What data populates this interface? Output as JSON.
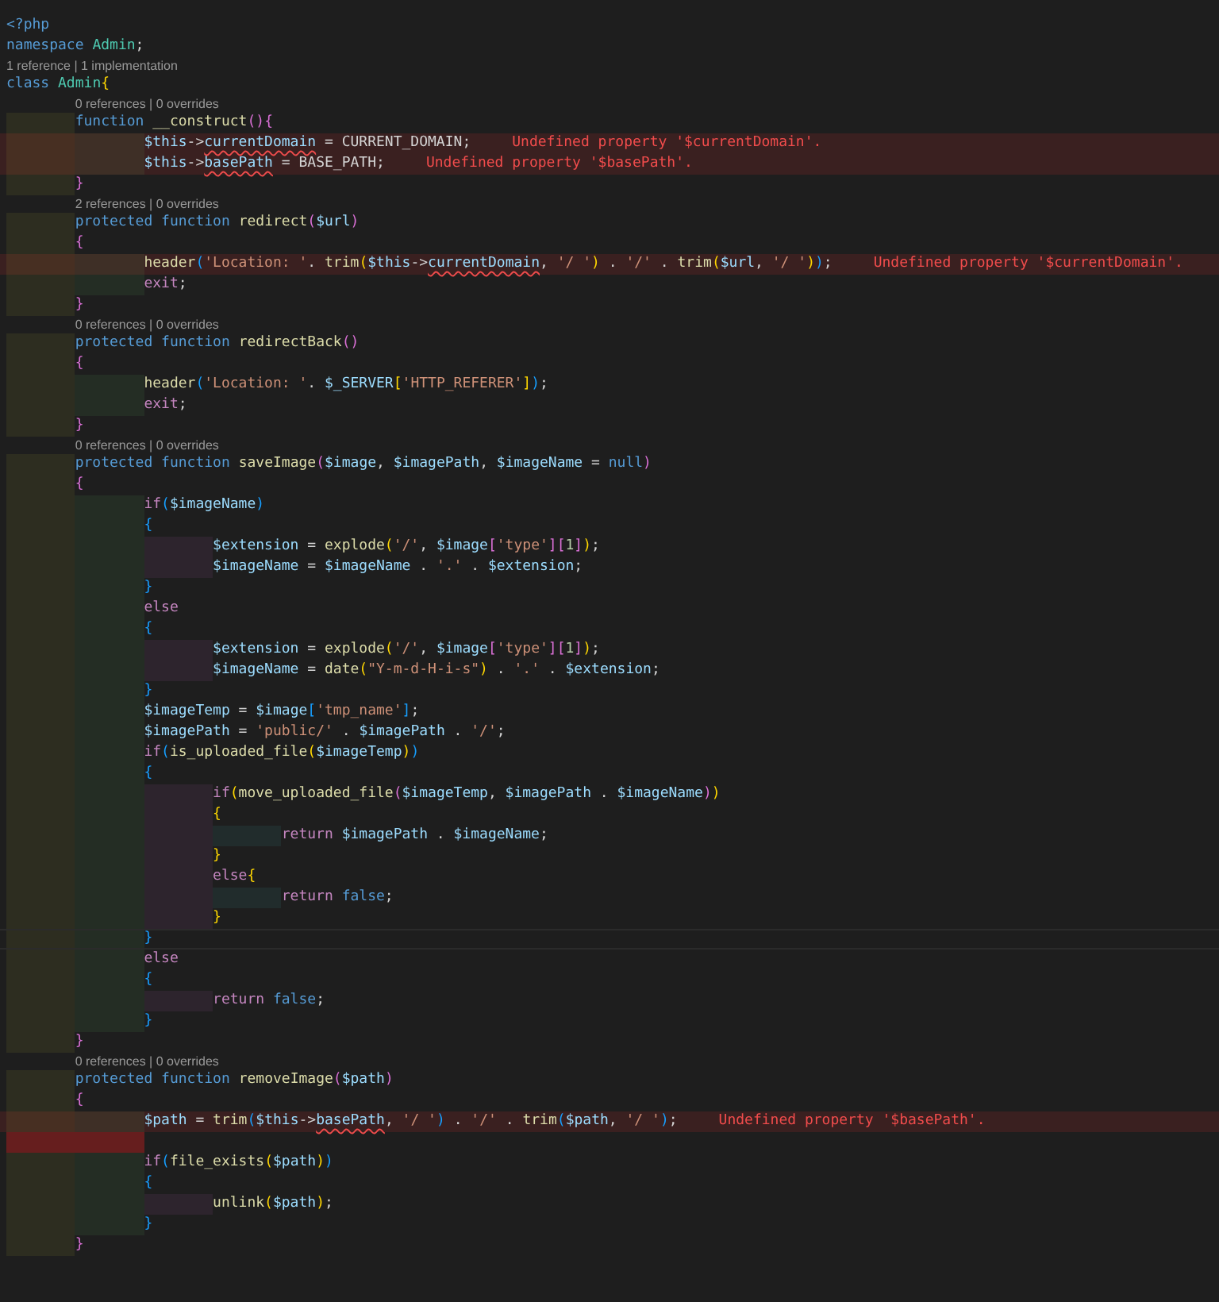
{
  "lines": [
    {
      "kind": "code",
      "tokens": [
        {
          "kind": "kw",
          "text": "<?php"
        }
      ]
    },
    {
      "kind": "code",
      "tokens": [
        {
          "kind": "kw",
          "text": "namespace "
        },
        {
          "kind": "cls",
          "text": "Admin"
        },
        {
          "kind": "txt",
          "text": ";"
        }
      ]
    },
    {
      "kind": "lens",
      "text": "1 reference | 1 implementation"
    },
    {
      "kind": "code",
      "tokens": [
        {
          "kind": "kw",
          "text": "class "
        },
        {
          "kind": "cls",
          "text": "Admin"
        },
        {
          "kind": "b1",
          "text": "{"
        }
      ],
      "children": [
        {
          "kind": "lens",
          "text": "0 references | 0 overrides"
        },
        {
          "kind": "code",
          "tokens": [
            {
              "kind": "kw",
              "text": "function "
            },
            {
              "kind": "fn",
              "text": "__construct"
            },
            {
              "kind": "b2",
              "text": "()"
            },
            {
              "kind": "b2",
              "text": "{"
            }
          ],
          "children": [
            {
              "kind": "code",
              "tokens": [
                {
                  "kind": "var",
                  "text": "$this"
                },
                {
                  "kind": "txt",
                  "text": "->"
                },
                {
                  "kind": "err",
                  "text": "currentDomain"
                },
                {
                  "kind": "txt",
                  "text": " = CURRENT_DOMAIN;"
                }
              ],
              "error": "Undefined property '$currentDomain'."
            },
            {
              "kind": "code",
              "tokens": [
                {
                  "kind": "var",
                  "text": "$this"
                },
                {
                  "kind": "txt",
                  "text": "->"
                },
                {
                  "kind": "err",
                  "text": "basePath"
                },
                {
                  "kind": "txt",
                  "text": " = BASE_PATH;"
                }
              ],
              "error": "Undefined property '$basePath'."
            }
          ]
        },
        {
          "kind": "code",
          "tokens": [
            {
              "kind": "b2",
              "text": "}"
            }
          ]
        },
        {
          "kind": "lens",
          "text": "2 references | 0 overrides"
        },
        {
          "kind": "code",
          "tokens": [
            {
              "kind": "kw",
              "text": "protected "
            },
            {
              "kind": "kw",
              "text": "function "
            },
            {
              "kind": "fn",
              "text": "redirect"
            },
            {
              "kind": "b2",
              "text": "("
            },
            {
              "kind": "var",
              "text": "$url"
            },
            {
              "kind": "b2",
              "text": ")"
            }
          ]
        },
        {
          "kind": "code",
          "tokens": [
            {
              "kind": "b2",
              "text": "{"
            }
          ],
          "children": [
            {
              "kind": "code",
              "tokens": [
                {
                  "kind": "fn",
                  "text": "header"
                },
                {
                  "kind": "b3",
                  "text": "("
                },
                {
                  "kind": "str",
                  "text": "'Location: '"
                },
                {
                  "kind": "txt",
                  "text": ". "
                },
                {
                  "kind": "fn",
                  "text": "trim"
                },
                {
                  "kind": "b1",
                  "text": "("
                },
                {
                  "kind": "var",
                  "text": "$this"
                },
                {
                  "kind": "txt",
                  "text": "->"
                },
                {
                  "kind": "err",
                  "text": "currentDomain"
                },
                {
                  "kind": "txt",
                  "text": ", "
                },
                {
                  "kind": "str",
                  "text": "'/ '"
                },
                {
                  "kind": "b1",
                  "text": ")"
                },
                {
                  "kind": "txt",
                  "text": " . "
                },
                {
                  "kind": "str",
                  "text": "'/'"
                },
                {
                  "kind": "txt",
                  "text": " . "
                },
                {
                  "kind": "fn",
                  "text": "trim"
                },
                {
                  "kind": "b1",
                  "text": "("
                },
                {
                  "kind": "var",
                  "text": "$url"
                },
                {
                  "kind": "txt",
                  "text": ", "
                },
                {
                  "kind": "str",
                  "text": "'/ '"
                },
                {
                  "kind": "b1",
                  "text": ")"
                },
                {
                  "kind": "b3",
                  "text": ")"
                },
                {
                  "kind": "txt",
                  "text": ";"
                }
              ],
              "error": "Undefined property '$currentDomain'."
            },
            {
              "kind": "code",
              "tokens": [
                {
                  "kind": "ctl",
                  "text": "exit"
                },
                {
                  "kind": "txt",
                  "text": ";"
                }
              ]
            }
          ]
        },
        {
          "kind": "code",
          "tokens": [
            {
              "kind": "b2",
              "text": "}"
            }
          ]
        },
        {
          "kind": "lens",
          "text": "0 references | 0 overrides"
        },
        {
          "kind": "code",
          "tokens": [
            {
              "kind": "kw",
              "text": "protected "
            },
            {
              "kind": "kw",
              "text": "function "
            },
            {
              "kind": "fn",
              "text": "redirectBack"
            },
            {
              "kind": "b2",
              "text": "()"
            }
          ]
        },
        {
          "kind": "code",
          "tokens": [
            {
              "kind": "b2",
              "text": "{"
            }
          ],
          "children": [
            {
              "kind": "code",
              "tokens": [
                {
                  "kind": "fn",
                  "text": "header"
                },
                {
                  "kind": "b3",
                  "text": "("
                },
                {
                  "kind": "str",
                  "text": "'Location: '"
                },
                {
                  "kind": "txt",
                  "text": ". "
                },
                {
                  "kind": "var",
                  "text": "$_SERVER"
                },
                {
                  "kind": "b1",
                  "text": "["
                },
                {
                  "kind": "str",
                  "text": "'HTTP_REFERER'"
                },
                {
                  "kind": "b1",
                  "text": "]"
                },
                {
                  "kind": "b3",
                  "text": ")"
                },
                {
                  "kind": "txt",
                  "text": ";"
                }
              ]
            },
            {
              "kind": "code",
              "tokens": [
                {
                  "kind": "ctl",
                  "text": "exit"
                },
                {
                  "kind": "txt",
                  "text": ";"
                }
              ]
            }
          ]
        },
        {
          "kind": "code",
          "tokens": [
            {
              "kind": "b2",
              "text": "}"
            }
          ]
        },
        {
          "kind": "lens",
          "text": "0 references | 0 overrides"
        },
        {
          "kind": "code",
          "tokens": [
            {
              "kind": "kw",
              "text": "protected "
            },
            {
              "kind": "kw",
              "text": "function "
            },
            {
              "kind": "fn",
              "text": "saveImage"
            },
            {
              "kind": "b2",
              "text": "("
            },
            {
              "kind": "var",
              "text": "$image"
            },
            {
              "kind": "txt",
              "text": ", "
            },
            {
              "kind": "var",
              "text": "$imagePath"
            },
            {
              "kind": "txt",
              "text": ", "
            },
            {
              "kind": "var",
              "text": "$imageName"
            },
            {
              "kind": "txt",
              "text": " = "
            },
            {
              "kind": "kw",
              "text": "null"
            },
            {
              "kind": "b2",
              "text": ")"
            }
          ]
        },
        {
          "kind": "code",
          "tokens": [
            {
              "kind": "b2",
              "text": "{"
            }
          ],
          "children": [
            {
              "kind": "code",
              "tokens": [
                {
                  "kind": "ctl",
                  "text": "if"
                },
                {
                  "kind": "b3",
                  "text": "("
                },
                {
                  "kind": "var",
                  "text": "$imageName"
                },
                {
                  "kind": "b3",
                  "text": ")"
                }
              ]
            },
            {
              "kind": "code",
              "tokens": [
                {
                  "kind": "b3",
                  "text": "{"
                }
              ],
              "children": [
                {
                  "kind": "code",
                  "tokens": [
                    {
                      "kind": "var",
                      "text": "$extension"
                    },
                    {
                      "kind": "txt",
                      "text": " = "
                    },
                    {
                      "kind": "fn",
                      "text": "explode"
                    },
                    {
                      "kind": "b1",
                      "text": "("
                    },
                    {
                      "kind": "str",
                      "text": "'/'"
                    },
                    {
                      "kind": "txt",
                      "text": ", "
                    },
                    {
                      "kind": "var",
                      "text": "$image"
                    },
                    {
                      "kind": "b2",
                      "text": "["
                    },
                    {
                      "kind": "str",
                      "text": "'type'"
                    },
                    {
                      "kind": "b2",
                      "text": "]["
                    },
                    {
                      "kind": "num",
                      "text": "1"
                    },
                    {
                      "kind": "b2",
                      "text": "]"
                    },
                    {
                      "kind": "b1",
                      "text": ")"
                    },
                    {
                      "kind": "txt",
                      "text": ";"
                    }
                  ]
                },
                {
                  "kind": "code",
                  "tokens": [
                    {
                      "kind": "var",
                      "text": "$imageName"
                    },
                    {
                      "kind": "txt",
                      "text": " = "
                    },
                    {
                      "kind": "var",
                      "text": "$imageName"
                    },
                    {
                      "kind": "txt",
                      "text": " . "
                    },
                    {
                      "kind": "str",
                      "text": "'.'"
                    },
                    {
                      "kind": "txt",
                      "text": " . "
                    },
                    {
                      "kind": "var",
                      "text": "$extension"
                    },
                    {
                      "kind": "txt",
                      "text": ";"
                    }
                  ]
                }
              ]
            },
            {
              "kind": "code",
              "tokens": [
                {
                  "kind": "b3",
                  "text": "}"
                }
              ]
            },
            {
              "kind": "code",
              "tokens": [
                {
                  "kind": "ctl",
                  "text": "else"
                }
              ]
            },
            {
              "kind": "code",
              "tokens": [
                {
                  "kind": "b3",
                  "text": "{"
                }
              ],
              "children": [
                {
                  "kind": "code",
                  "tokens": [
                    {
                      "kind": "var",
                      "text": "$extension"
                    },
                    {
                      "kind": "txt",
                      "text": " = "
                    },
                    {
                      "kind": "fn",
                      "text": "explode"
                    },
                    {
                      "kind": "b1",
                      "text": "("
                    },
                    {
                      "kind": "str",
                      "text": "'/'"
                    },
                    {
                      "kind": "txt",
                      "text": ", "
                    },
                    {
                      "kind": "var",
                      "text": "$image"
                    },
                    {
                      "kind": "b2",
                      "text": "["
                    },
                    {
                      "kind": "str",
                      "text": "'type'"
                    },
                    {
                      "kind": "b2",
                      "text": "]["
                    },
                    {
                      "kind": "num",
                      "text": "1"
                    },
                    {
                      "kind": "b2",
                      "text": "]"
                    },
                    {
                      "kind": "b1",
                      "text": ")"
                    },
                    {
                      "kind": "txt",
                      "text": ";"
                    }
                  ]
                },
                {
                  "kind": "code",
                  "tokens": [
                    {
                      "kind": "var",
                      "text": "$imageName"
                    },
                    {
                      "kind": "txt",
                      "text": " = "
                    },
                    {
                      "kind": "fn",
                      "text": "date"
                    },
                    {
                      "kind": "b1",
                      "text": "("
                    },
                    {
                      "kind": "str",
                      "text": "\"Y-m-d-H-i-s\""
                    },
                    {
                      "kind": "b1",
                      "text": ")"
                    },
                    {
                      "kind": "txt",
                      "text": " . "
                    },
                    {
                      "kind": "str",
                      "text": "'.'"
                    },
                    {
                      "kind": "txt",
                      "text": " . "
                    },
                    {
                      "kind": "var",
                      "text": "$extension"
                    },
                    {
                      "kind": "txt",
                      "text": ";"
                    }
                  ]
                }
              ]
            },
            {
              "kind": "code",
              "tokens": [
                {
                  "kind": "b3",
                  "text": "}"
                }
              ]
            },
            {
              "kind": "code",
              "tokens": [
                {
                  "kind": "var",
                  "text": "$imageTemp"
                },
                {
                  "kind": "txt",
                  "text": " = "
                },
                {
                  "kind": "var",
                  "text": "$image"
                },
                {
                  "kind": "b3",
                  "text": "["
                },
                {
                  "kind": "str",
                  "text": "'tmp_name'"
                },
                {
                  "kind": "b3",
                  "text": "]"
                },
                {
                  "kind": "txt",
                  "text": ";"
                }
              ]
            },
            {
              "kind": "code",
              "tokens": [
                {
                  "kind": "var",
                  "text": "$imagePath"
                },
                {
                  "kind": "txt",
                  "text": " = "
                },
                {
                  "kind": "str",
                  "text": "'public/'"
                },
                {
                  "kind": "txt",
                  "text": " . "
                },
                {
                  "kind": "var",
                  "text": "$imagePath"
                },
                {
                  "kind": "txt",
                  "text": " . "
                },
                {
                  "kind": "str",
                  "text": "'/'"
                },
                {
                  "kind": "txt",
                  "text": ";"
                }
              ]
            },
            {
              "kind": "code",
              "tokens": [
                {
                  "kind": "ctl",
                  "text": "if"
                },
                {
                  "kind": "b3",
                  "text": "("
                },
                {
                  "kind": "fn",
                  "text": "is_uploaded_file"
                },
                {
                  "kind": "b1",
                  "text": "("
                },
                {
                  "kind": "var",
                  "text": "$imageTemp"
                },
                {
                  "kind": "b1",
                  "text": ")"
                },
                {
                  "kind": "b3",
                  "text": ")"
                }
              ]
            },
            {
              "kind": "code",
              "tokens": [
                {
                  "kind": "b3",
                  "text": "{"
                }
              ],
              "children": [
                {
                  "kind": "code",
                  "tokens": [
                    {
                      "kind": "ctl",
                      "text": "if"
                    },
                    {
                      "kind": "b1",
                      "text": "("
                    },
                    {
                      "kind": "fn",
                      "text": "move_uploaded_file"
                    },
                    {
                      "kind": "b2",
                      "text": "("
                    },
                    {
                      "kind": "var",
                      "text": "$imageTemp"
                    },
                    {
                      "kind": "txt",
                      "text": ", "
                    },
                    {
                      "kind": "var",
                      "text": "$imagePath"
                    },
                    {
                      "kind": "txt",
                      "text": " . "
                    },
                    {
                      "kind": "var",
                      "text": "$imageName"
                    },
                    {
                      "kind": "b2",
                      "text": ")"
                    },
                    {
                      "kind": "b1",
                      "text": ")"
                    }
                  ]
                },
                {
                  "kind": "code",
                  "tokens": [
                    {
                      "kind": "b1",
                      "text": "{"
                    }
                  ],
                  "children": [
                    {
                      "kind": "code",
                      "tokens": [
                        {
                          "kind": "ctl",
                          "text": "return "
                        },
                        {
                          "kind": "var",
                          "text": "$imagePath"
                        },
                        {
                          "kind": "txt",
                          "text": " . "
                        },
                        {
                          "kind": "var",
                          "text": "$imageName"
                        },
                        {
                          "kind": "txt",
                          "text": ";"
                        }
                      ]
                    }
                  ]
                },
                {
                  "kind": "code",
                  "tokens": [
                    {
                      "kind": "b1",
                      "text": "}"
                    }
                  ]
                },
                {
                  "kind": "code",
                  "tokens": [
                    {
                      "kind": "ctl",
                      "text": "else"
                    },
                    {
                      "kind": "b1",
                      "text": "{"
                    }
                  ],
                  "children": [
                    {
                      "kind": "code",
                      "tokens": [
                        {
                          "kind": "ctl",
                          "text": "return "
                        },
                        {
                          "kind": "kw",
                          "text": "false"
                        },
                        {
                          "kind": "txt",
                          "text": ";"
                        }
                      ]
                    }
                  ]
                },
                {
                  "kind": "code",
                  "tokens": [
                    {
                      "kind": "b1",
                      "text": "}"
                    }
                  ]
                }
              ]
            },
            {
              "kind": "code",
              "tokens": [
                {
                  "kind": "b3",
                  "text": "}"
                }
              ],
              "current": true
            },
            {
              "kind": "code",
              "tokens": [
                {
                  "kind": "ctl",
                  "text": "else"
                }
              ]
            },
            {
              "kind": "code",
              "tokens": [
                {
                  "kind": "b3",
                  "text": "{"
                }
              ],
              "children": [
                {
                  "kind": "code",
                  "tokens": [
                    {
                      "kind": "ctl",
                      "text": "return "
                    },
                    {
                      "kind": "kw",
                      "text": "false"
                    },
                    {
                      "kind": "txt",
                      "text": ";"
                    }
                  ]
                }
              ]
            },
            {
              "kind": "code",
              "tokens": [
                {
                  "kind": "b3",
                  "text": "}"
                }
              ]
            }
          ]
        },
        {
          "kind": "code",
          "tokens": [
            {
              "kind": "b2",
              "text": "}"
            }
          ]
        },
        {
          "kind": "lens",
          "text": "0 references | 0 overrides"
        },
        {
          "kind": "code",
          "tokens": [
            {
              "kind": "kw",
              "text": "protected "
            },
            {
              "kind": "kw",
              "text": "function "
            },
            {
              "kind": "fn",
              "text": "removeImage"
            },
            {
              "kind": "b2",
              "text": "("
            },
            {
              "kind": "var",
              "text": "$path"
            },
            {
              "kind": "b2",
              "text": ")"
            }
          ]
        },
        {
          "kind": "code",
          "tokens": [
            {
              "kind": "b2",
              "text": "{"
            }
          ],
          "children": [
            {
              "kind": "code",
              "tokens": [
                {
                  "kind": "var",
                  "text": "$path"
                },
                {
                  "kind": "txt",
                  "text": " = "
                },
                {
                  "kind": "fn",
                  "text": "trim"
                },
                {
                  "kind": "b3",
                  "text": "("
                },
                {
                  "kind": "var",
                  "text": "$this"
                },
                {
                  "kind": "txt",
                  "text": "->"
                },
                {
                  "kind": "err",
                  "text": "basePath"
                },
                {
                  "kind": "txt",
                  "text": ", "
                },
                {
                  "kind": "str",
                  "text": "'/ '"
                },
                {
                  "kind": "b3",
                  "text": ")"
                },
                {
                  "kind": "txt",
                  "text": " . "
                },
                {
                  "kind": "str",
                  "text": "'/'"
                },
                {
                  "kind": "txt",
                  "text": " . "
                },
                {
                  "kind": "fn",
                  "text": "trim"
                },
                {
                  "kind": "b3",
                  "text": "("
                },
                {
                  "kind": "var",
                  "text": "$path"
                },
                {
                  "kind": "txt",
                  "text": ", "
                },
                {
                  "kind": "str",
                  "text": "'/ '"
                },
                {
                  "kind": "b3",
                  "text": ")"
                },
                {
                  "kind": "txt",
                  "text": ";"
                }
              ],
              "error": "Undefined property '$basePath'."
            },
            {
              "kind": "code",
              "indent_error": true
            },
            {
              "kind": "code",
              "tokens": [
                {
                  "kind": "ctl",
                  "text": "if"
                },
                {
                  "kind": "b3",
                  "text": "("
                },
                {
                  "kind": "fn",
                  "text": "file_exists"
                },
                {
                  "kind": "b1",
                  "text": "("
                },
                {
                  "kind": "var",
                  "text": "$path"
                },
                {
                  "kind": "b1",
                  "text": ")"
                },
                {
                  "kind": "b3",
                  "text": ")"
                }
              ]
            },
            {
              "kind": "code",
              "tokens": [
                {
                  "kind": "b3",
                  "text": "{"
                }
              ],
              "children": [
                {
                  "kind": "code",
                  "tokens": [
                    {
                      "kind": "fn",
                      "text": "unlink"
                    },
                    {
                      "kind": "b1",
                      "text": "("
                    },
                    {
                      "kind": "var",
                      "text": "$path"
                    },
                    {
                      "kind": "b1",
                      "text": ")"
                    },
                    {
                      "kind": "txt",
                      "text": ";"
                    }
                  ]
                }
              ]
            },
            {
              "kind": "code",
              "tokens": [
                {
                  "kind": "b3",
                  "text": "}"
                }
              ]
            }
          ]
        },
        {
          "kind": "code",
          "tokens": [
            {
              "kind": "b2",
              "text": "}"
            }
          ]
        }
      ]
    }
  ]
}
